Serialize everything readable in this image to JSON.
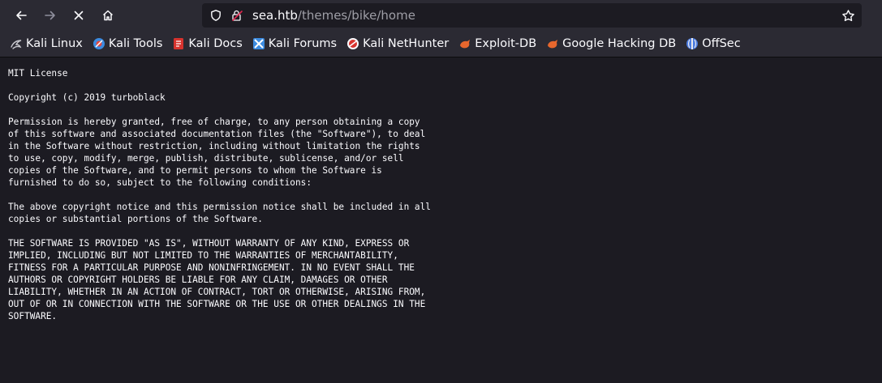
{
  "browser": {
    "url_host": "sea.htb",
    "url_path": "/themes/bike/home",
    "icons": {
      "back": "arrow-left-icon",
      "forward": "arrow-right-icon",
      "stop": "close-icon",
      "home": "home-icon",
      "tracking": "shield-icon",
      "security": "lock-warning-icon",
      "bookmark": "star-icon"
    }
  },
  "bookmarks": [
    {
      "label": "Kali Linux",
      "icon": "kali-dragon-icon",
      "color": "#c9c9cf"
    },
    {
      "label": "Kali Tools",
      "icon": "kali-tools-icon",
      "color": "#e3483f"
    },
    {
      "label": "Kali Docs",
      "icon": "kali-docs-icon",
      "color": "#d7332e"
    },
    {
      "label": "Kali Forums",
      "icon": "kali-forums-icon",
      "color": "#3c8be0"
    },
    {
      "label": "Kali NetHunter",
      "icon": "kali-nethunter-icon",
      "color": "#d7332e"
    },
    {
      "label": "Exploit-DB",
      "icon": "exploit-db-icon",
      "color": "#e8672d"
    },
    {
      "label": "Google Hacking DB",
      "icon": "ghdb-icon",
      "color": "#e8672d"
    },
    {
      "label": "OffSec",
      "icon": "offsec-icon",
      "color": "#4a7be0"
    }
  ],
  "document": {
    "text": "MIT License\n\nCopyright (c) 2019 turboblack\n\nPermission is hereby granted, free of charge, to any person obtaining a copy\nof this software and associated documentation files (the \"Software\"), to deal\nin the Software without restriction, including without limitation the rights\nto use, copy, modify, merge, publish, distribute, sublicense, and/or sell\ncopies of the Software, and to permit persons to whom the Software is\nfurnished to do so, subject to the following conditions:\n\nThe above copyright notice and this permission notice shall be included in all\ncopies or substantial portions of the Software.\n\nTHE SOFTWARE IS PROVIDED \"AS IS\", WITHOUT WARRANTY OF ANY KIND, EXPRESS OR\nIMPLIED, INCLUDING BUT NOT LIMITED TO THE WARRANTIES OF MERCHANTABILITY,\nFITNESS FOR A PARTICULAR PURPOSE AND NONINFRINGEMENT. IN NO EVENT SHALL THE\nAUTHORS OR COPYRIGHT HOLDERS BE LIABLE FOR ANY CLAIM, DAMAGES OR OTHER\nLIABILITY, WHETHER IN AN ACTION OF CONTRACT, TORT OR OTHERWISE, ARISING FROM,\nOUT OF OR IN CONNECTION WITH THE SOFTWARE OR THE USE OR OTHER DEALINGS IN THE\nSOFTWARE."
  }
}
